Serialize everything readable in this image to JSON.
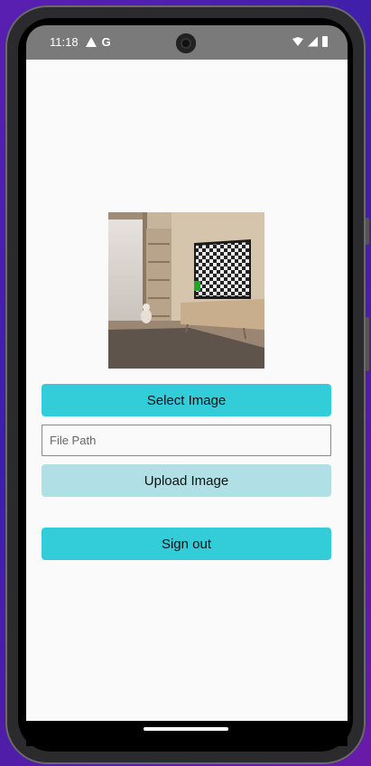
{
  "status_bar": {
    "time": "11:18",
    "left_icons": [
      "warning-icon",
      "google-icon"
    ],
    "google_letter": "G",
    "right_icons": [
      "wifi-icon",
      "signal-icon",
      "battery-icon"
    ]
  },
  "main": {
    "image_preview": {
      "description_icon": "image-preview"
    },
    "select_button_label": "Select Image",
    "file_path": {
      "value": "",
      "placeholder": "File Path"
    },
    "upload_button_label": "Upload Image",
    "signout_button_label": "Sign out"
  },
  "colors": {
    "accent": "#33ccd9",
    "accent_light": "#b0e0e6",
    "status_bar": "#7a7a7a",
    "background": "#fafafa"
  }
}
